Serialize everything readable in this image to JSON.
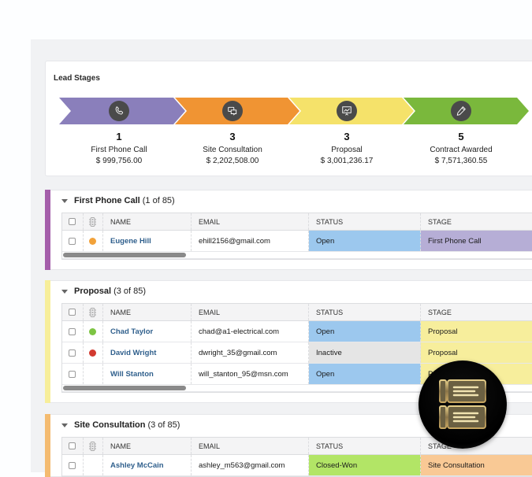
{
  "lead_stages": {
    "title": "Lead Stages",
    "stages": [
      {
        "count": "1",
        "name": "First Phone Call",
        "amount": "$ 999,756.00",
        "icon": "phone-icon",
        "color": "#8a7fbb"
      },
      {
        "count": "3",
        "name": "Site Consultation",
        "amount": "$ 2,202,508.00",
        "icon": "chat-bubbles-icon",
        "color": "#f09433"
      },
      {
        "count": "3",
        "name": "Proposal",
        "amount": "$ 3,001,236.17",
        "icon": "presentation-chart-icon",
        "color": "#f5e26a"
      },
      {
        "count": "5",
        "name": "Contract Awarded",
        "amount": "$ 7,571,360.55",
        "icon": "pen-icon",
        "color": "#7ab83c"
      }
    ]
  },
  "columns": {
    "name": "NAME",
    "email": "EMAIL",
    "status": "STATUS",
    "stage": "STAGE",
    "light_icon": "traffic-light-icon"
  },
  "sections": [
    {
      "title": "First Phone Call",
      "count": "(1 of 85)",
      "bar_color": "#a45eaa",
      "rows": [
        {
          "light": "#f2a23a",
          "name": "Eugene Hill",
          "email": "ehill2156@gmail.com",
          "status": "Open",
          "status_color": "#9cc8ee",
          "stage": "First Phone Call",
          "stage_color": "#b6aed6"
        }
      ]
    },
    {
      "title": "Proposal",
      "count": "(3 of 85)",
      "bar_color": "#f7ee9a",
      "rows": [
        {
          "light": "#7dc443",
          "name": "Chad Taylor",
          "email": "chad@a1-electrical.com",
          "status": "Open",
          "status_color": "#9cc8ee",
          "stage": "Proposal",
          "stage_color": "#f7ee9c"
        },
        {
          "light": "#d23a30",
          "name": "David Wright",
          "email": "dwright_35@gmail.com",
          "status": "Inactive",
          "status_color": "#e5e5e5",
          "stage": "Proposal",
          "stage_color": "#f7ee9c"
        },
        {
          "light": "",
          "name": "Will Stanton",
          "email": "will_stanton_95@msn.com",
          "status": "Open",
          "status_color": "#9cc8ee",
          "stage": "Proposal",
          "stage_color": "#f7ee9c"
        }
      ]
    },
    {
      "title": "Site Consultation",
      "count": "(3 of 85)",
      "bar_color": "#f4bb70",
      "rows": [
        {
          "light": "",
          "name": "Ashley McCain",
          "email": "ashley_m563@gmail.com",
          "status": "Closed-Won",
          "status_color": "#b2e566",
          "stage": "Site Consultation",
          "stage_color": "#f9c995"
        }
      ]
    }
  ],
  "floating_button": {
    "icon": "kanban-board-icon"
  }
}
